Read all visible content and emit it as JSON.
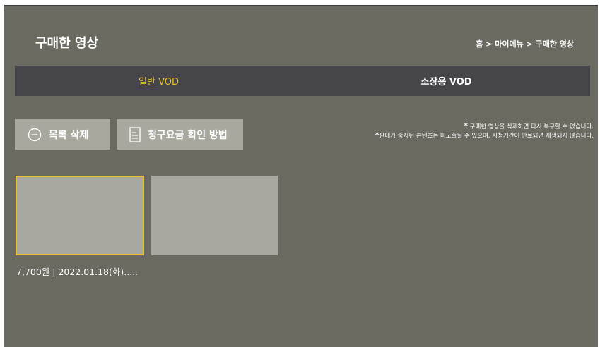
{
  "header": {
    "title": "구매한 영상",
    "breadcrumb": "홈 > 마이메뉴 > 구매한 영상"
  },
  "tabs": [
    {
      "label": "일반 VOD",
      "active": true
    },
    {
      "label": "소장용 VOD",
      "active": false
    }
  ],
  "actions": {
    "delete_label": "목록 삭제",
    "billing_label": "청구요금 확인 방법"
  },
  "notices": [
    {
      "star": "*",
      "text": "구매한 영상을 삭제하면 다시 복구할 수 없습니다."
    },
    {
      "star": "*",
      "text": "판매가 중지된 콘텐츠는 미노출될 수 있으며, 시청기간이 만료되면 재생되지 않습니다."
    }
  ],
  "items": [
    {
      "caption": "7,700원 | 2022.01.18(화).....",
      "selected": true
    },
    {
      "caption": "",
      "selected": false
    }
  ],
  "colors": {
    "background": "#6b6a61",
    "tab_bar": "#45454a",
    "accent": "#e8c22a",
    "button": "#a8a89f",
    "thumbnail": "#a8a8a0"
  },
  "icons": {
    "delete": "minus-circle-icon",
    "billing": "document-icon"
  }
}
